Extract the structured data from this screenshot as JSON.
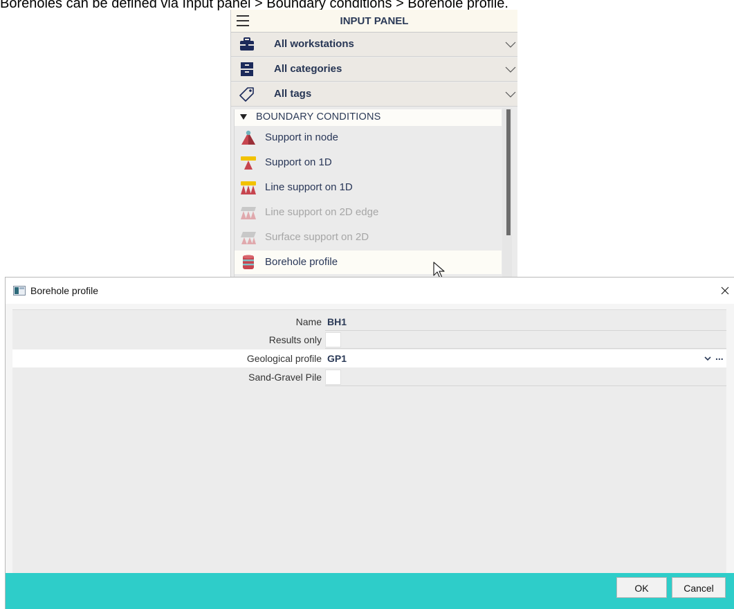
{
  "caption": "Boreholes can be defined via Input panel > Boundary conditions > Borehole profile.",
  "input_panel": {
    "title": "INPUT PANEL",
    "filters": [
      {
        "label": "All workstations",
        "icon": "toolbox-icon"
      },
      {
        "label": "All categories",
        "icon": "drawers-icon"
      },
      {
        "label": "All tags",
        "icon": "tag-icon"
      }
    ],
    "group": {
      "label": "BOUNDARY CONDITIONS",
      "items": [
        {
          "label": "Support in node",
          "icon": "support-in-node-icon",
          "enabled": true
        },
        {
          "label": "Support on 1D",
          "icon": "support-on-1d-icon",
          "enabled": true
        },
        {
          "label": "Line support on 1D",
          "icon": "line-support-1d-icon",
          "enabled": true
        },
        {
          "label": "Line support on 2D edge",
          "icon": "line-support-2d-edge-icon",
          "enabled": false
        },
        {
          "label": "Surface support on 2D",
          "icon": "surface-support-2d-icon",
          "enabled": false
        },
        {
          "label": "Borehole profile",
          "icon": "borehole-icon",
          "enabled": true,
          "highlighted": true
        }
      ]
    }
  },
  "dialog": {
    "title": "Borehole profile",
    "properties": [
      {
        "label": "Name",
        "value": "BH1",
        "type": "text"
      },
      {
        "label": "Results only",
        "type": "checkbox",
        "checked": false
      },
      {
        "label": "Geological profile",
        "value": "GP1",
        "type": "select",
        "more": "..."
      },
      {
        "label": "Sand-Gravel Pile",
        "type": "checkbox",
        "checked": false
      }
    ],
    "buttons": {
      "ok": "OK",
      "cancel": "Cancel"
    }
  },
  "colors": {
    "footer": "#2ecdc9",
    "label_text": "#2b3a57",
    "support_red": "#c0404a",
    "support_yellow": "#f2c200"
  }
}
